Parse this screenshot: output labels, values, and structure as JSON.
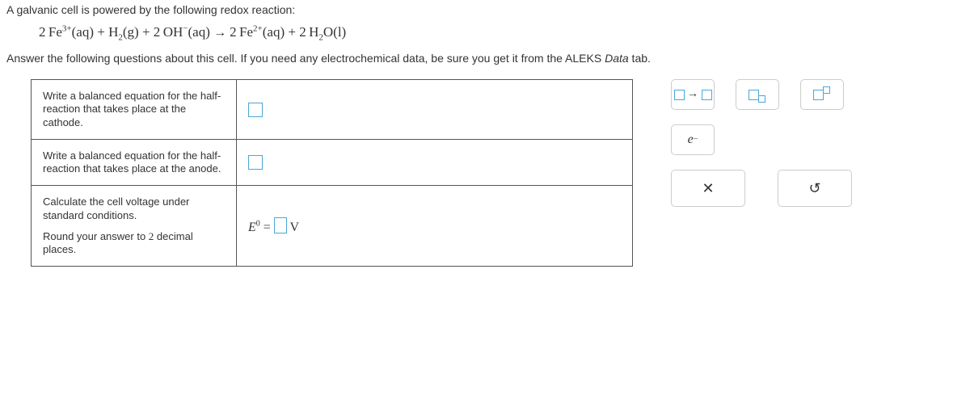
{
  "intro": "A galvanic cell is powered by the following redox reaction:",
  "prompt2_pre": "Answer the following questions about this cell. If you need any electrochemical data, be sure you get it from the ALEKS ",
  "prompt2_italic": "Data",
  "prompt2_post": " tab.",
  "q1": "Write a balanced equation for the half-reaction that takes place at the cathode.",
  "q2": "Write a balanced equation for the half-reaction that takes place at the anode.",
  "q3a": "Calculate the cell voltage under standard conditions.",
  "q3b_pre": "Round your answer to ",
  "q3b_num": "2",
  "q3b_post": " decimal places.",
  "e0_E": "E",
  "e0_sup": "0",
  "e0_eq": " = ",
  "e0_V": " V",
  "eq": {
    "c1": "2",
    "sp1": "Fe",
    "sup1": "3+",
    "ph1": "(aq)",
    "plus": " + ",
    "sp2": "H",
    "sub2": "2",
    "ph2": "(g)",
    "c3": "2",
    "sp3": "OH",
    "sup3": "−",
    "ph3": "(aq)",
    "arrow": " → ",
    "c4": "2",
    "sp4": "Fe",
    "sup4": "2+",
    "ph4": "(aq)",
    "c5": "2",
    "sp5": "H",
    "sub5": "2",
    "sp5b": "O",
    "ph5": "(l)"
  },
  "palette": {
    "electron_e": "e",
    "electron_sup": "−",
    "clear": "✕",
    "reset": "↺"
  }
}
